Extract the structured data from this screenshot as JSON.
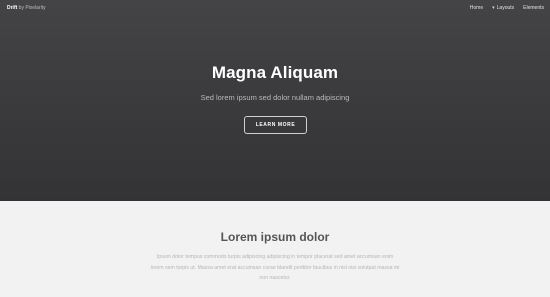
{
  "header": {
    "brand_name": "Drift",
    "brand_by": "by Pixelarity",
    "nav": [
      {
        "label": "Home"
      },
      {
        "label": "Layouts",
        "icon": "chevron-down-icon"
      },
      {
        "label": "Elements"
      }
    ]
  },
  "hero": {
    "title": "Magna Aliquam",
    "subtitle": "Sed lorem ipsum sed dolor nullam adipiscing",
    "button_label": "LEARN MORE"
  },
  "section": {
    "title": "Lorem ipsum dolor",
    "text": "Ipsum dolor tempus commodo turpis adipiscing adipiscing in tempor placerat sed amet accumsan enim lorem sem turpis ut. Massa amet erat accumsan curae blandit porttitor faucibus in nisl nisi volutpat massa mi non nascetur."
  }
}
